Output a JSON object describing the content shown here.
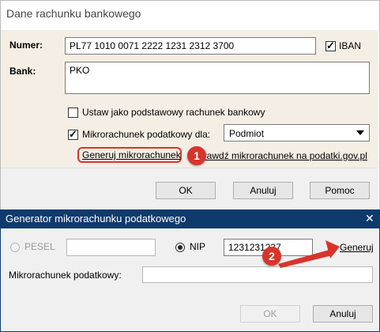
{
  "dialog_main": {
    "title": "Dane rachunku bankowego",
    "numer_label": "Numer:",
    "numer_value": "PL77 1010 0071 2222 1231 2312 3700",
    "iban_label": "IBAN",
    "bank_label": "Bank:",
    "bank_value": "PKO",
    "default_account_label": "Ustaw jako podstawowy rachunek bankowy",
    "tax_subaccount_label": "Mikrorachunek podatkowy dla:",
    "tax_subaccount_select": "Podmiot",
    "generate_link": "Generuj mikrorachunek",
    "check_link": "Sprawdź mikrorachunek na podatki.gov.pl",
    "ok_label": "OK",
    "cancel_label": "Anuluj",
    "help_label": "Pomoc",
    "checkboxes": {
      "iban": true,
      "default_account": false,
      "tax_subaccount": true
    }
  },
  "dialog_generator": {
    "title": "Generator mikrorachunku podatkowego",
    "close_glyph": "✕",
    "pesel_label": "PESEL",
    "pesel_value": "",
    "nip_label": "NIP",
    "nip_value": "1231231237",
    "generate_link": "Generuj",
    "subaccount_label": "Mikrorachunek podatkowy:",
    "subaccount_value": "",
    "ok_label": "OK",
    "cancel_label": "Anuluj",
    "selected_option": "NIP"
  },
  "annotations": {
    "badge1": "1",
    "badge2": "2",
    "color": "#d9342b"
  },
  "colors": {
    "title_bar": "#0f3b6c",
    "panel_bg": "#f5eee4"
  }
}
